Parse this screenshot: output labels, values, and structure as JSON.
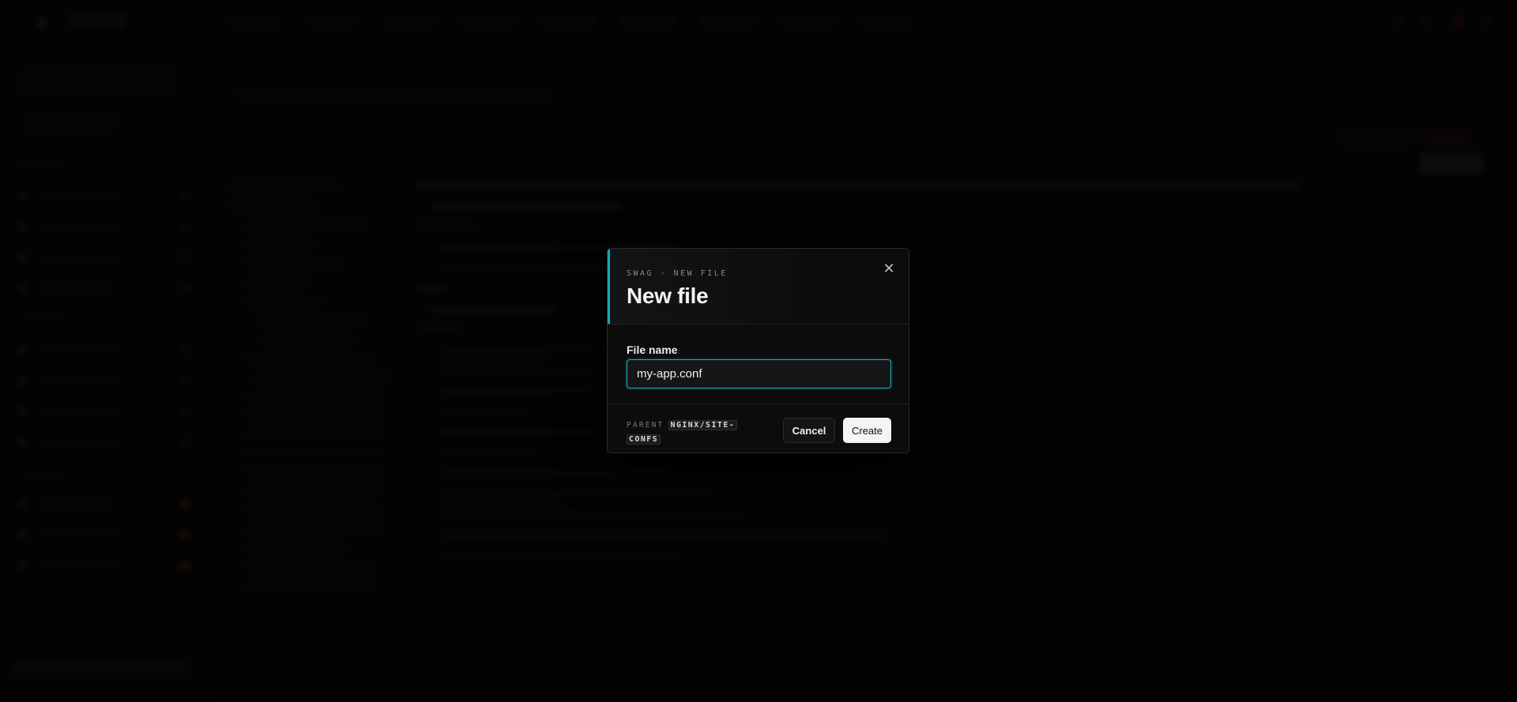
{
  "dialog": {
    "kicker": "SWAG · NEW FILE",
    "title": "New file",
    "close_glyph": "✕",
    "field_label": "File name",
    "file_name_value": "my-app.conf",
    "parent_label": "PARENT",
    "parent_path": "NGINX/SITE-CONFS",
    "cancel_label": "Cancel",
    "create_label": "Create"
  },
  "icons": {
    "close": "close-icon"
  },
  "colors": {
    "accent": "#17a8ae",
    "input_border": "#1fb3b8",
    "primary_button_bg": "#f4f4f5",
    "modal_bg": "#0c0c0d"
  }
}
